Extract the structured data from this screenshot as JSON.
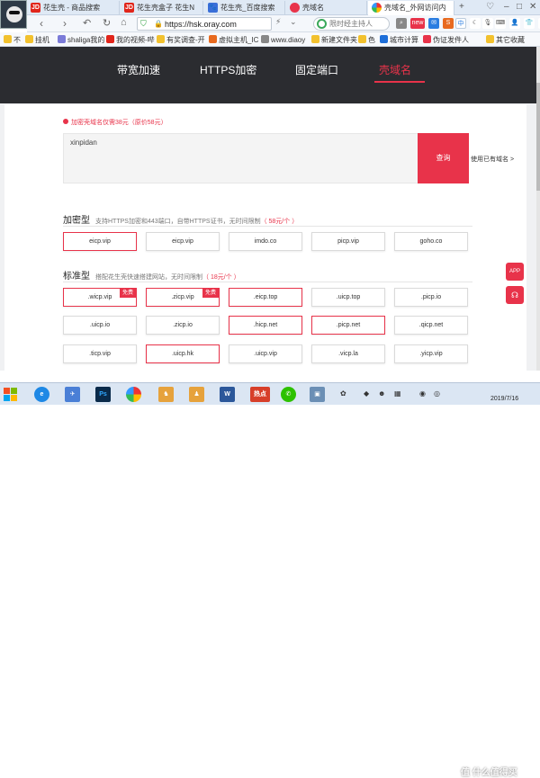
{
  "browser": {
    "tabs": [
      {
        "icon": "JD",
        "label": "花生壳 - 商品搜索"
      },
      {
        "icon": "JD",
        "label": "花生壳盒子 花生N"
      },
      {
        "icon": "",
        "label": "花生壳_百度搜索"
      },
      {
        "icon": "",
        "label": "壳域名"
      },
      {
        "icon": "",
        "label": "壳域名_外网访问内"
      }
    ],
    "url": "https://hsk.oray.com",
    "search_placeholder": "限时经主持人",
    "bookmarks": [
      "不",
      "挂机",
      "shaliga我的",
      "我的视频-哔",
      "有奖调查-开",
      "虚拟主机_IC",
      "www.diaoy",
      "新建文件夹",
      "色",
      "城市计算",
      "伪证发件人"
    ],
    "bookmarks_more": "其它收藏"
  },
  "site": {
    "nav": [
      "带宽加速",
      "HTTPS加密",
      "固定端口",
      "壳域名"
    ],
    "promo": "加密壳域名仅需38元（原价58元）",
    "input_value": "xinpidan",
    "query_label": "查询",
    "own_domain": "使用已有域名 >",
    "encrypted": {
      "title": "加密型",
      "desc": "支持HTTPS加密和443端口，自带HTTPS证书，无时间限制",
      "price": "（ 58元/个 ）",
      "chips": [
        "eicp.vip",
        "eicp.vip",
        "imdo.co",
        "picp.vip",
        "goho.co"
      ]
    },
    "standard": {
      "title": "标准型",
      "desc": "搭配花生壳快速搭建网站，无时间限制",
      "price": "（ 18元/个 ）",
      "free_badge": "免费",
      "rows": [
        [
          ".wicp.vip",
          ".zicp.vip",
          ".eicp.top",
          ".uicp.top",
          ".picp.io"
        ],
        [
          ".uicp.io",
          ".zicp.io",
          ".hicp.net",
          ".picp.net",
          ".qicp.net"
        ],
        [
          ".ticp.vip",
          ".uicp.hk",
          ".uicp.vip",
          ".vicp.la",
          ".yicp.vip"
        ]
      ]
    },
    "float_buttons": [
      "APP",
      "客服"
    ]
  },
  "taskbar": {
    "clock_date": "2019/7/16",
    "clock_time": "",
    "watermark": "值 什么值得买"
  },
  "colors": {
    "accent": "#e8334a",
    "nav_bg": "#2b2c30"
  }
}
